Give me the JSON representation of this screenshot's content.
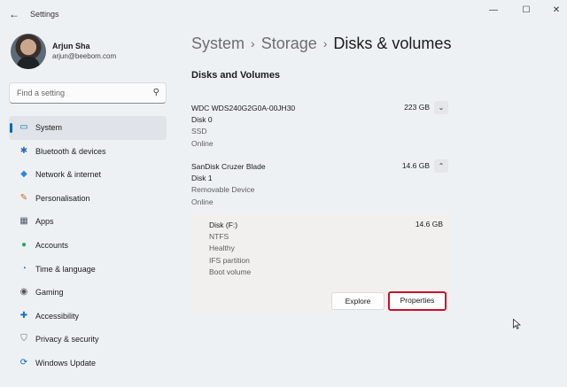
{
  "window": {
    "title": "Settings",
    "back_glyph": "←",
    "controls": {
      "minimize": "—",
      "maximize": "☐",
      "close": "✕"
    }
  },
  "profile": {
    "name": "Arjun Sha",
    "email": "arjun@beebom.com"
  },
  "search": {
    "placeholder": "Find a setting",
    "icon": "⚲"
  },
  "nav": [
    {
      "label": "System",
      "icon": "▭",
      "icon_color": "#0067c0",
      "active": true
    },
    {
      "label": "Bluetooth & devices",
      "icon": "✱",
      "icon_color": "#2b6cb0"
    },
    {
      "label": "Network & internet",
      "icon": "◆",
      "icon_color": "#2f86d6"
    },
    {
      "label": "Personalisation",
      "icon": "✎",
      "icon_color": "#c06a2b"
    },
    {
      "label": "Apps",
      "icon": "▦",
      "icon_color": "#4a5a6a"
    },
    {
      "label": "Accounts",
      "icon": "●",
      "icon_color": "#2ea36b"
    },
    {
      "label": "Time & language",
      "icon": "◔",
      "icon_color": "#2f86d6"
    },
    {
      "label": "Gaming",
      "icon": "◉",
      "icon_color": "#555555"
    },
    {
      "label": "Accessibility",
      "icon": "✚",
      "icon_color": "#1e6fbf"
    },
    {
      "label": "Privacy & security",
      "icon": "⛉",
      "icon_color": "#666666"
    },
    {
      "label": "Windows Update",
      "icon": "⟳",
      "icon_color": "#0067c0"
    }
  ],
  "breadcrumb": {
    "part1": "System",
    "part2": "Storage",
    "current": "Disks & volumes",
    "sep": "›"
  },
  "section_title": "Disks and Volumes",
  "disks": [
    {
      "name": "WDC WDS240G2G0A-00JH30",
      "disk": "Disk 0",
      "type": "SSD",
      "status": "Online",
      "size": "223 GB",
      "chevron": "⌄"
    },
    {
      "name": "SanDisk Cruzer Blade",
      "disk": "Disk 1",
      "type": "Removable Device",
      "status": "Online",
      "size": "14.6 GB",
      "chevron": "⌃"
    }
  ],
  "volume": {
    "name": "Disk (F:)",
    "size": "14.6 GB",
    "fs": "NTFS",
    "health": "Healthy",
    "partition": "IFS partition",
    "role": "Boot volume",
    "explore_label": "Explore",
    "properties_label": "Properties"
  }
}
